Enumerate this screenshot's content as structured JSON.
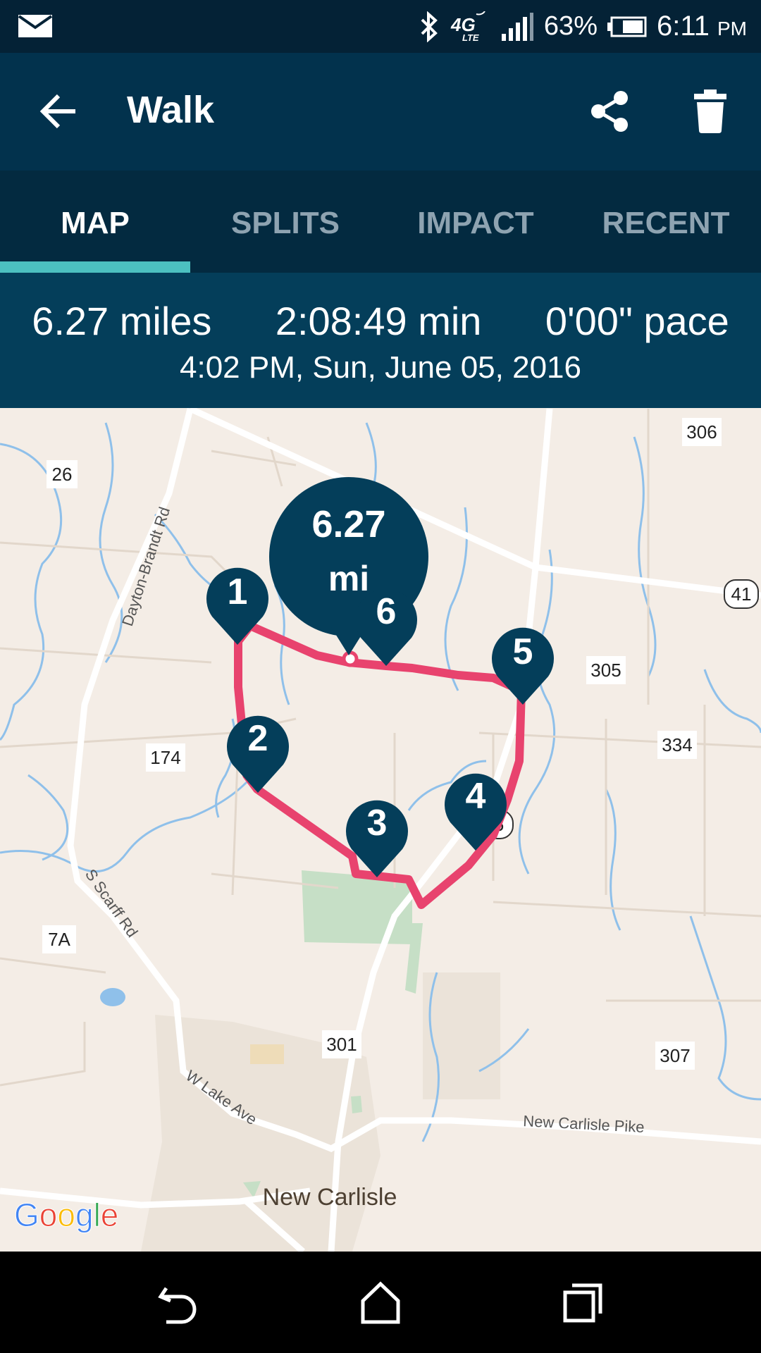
{
  "status_bar": {
    "battery": "63%",
    "time": "6:11",
    "ampm": "PM",
    "network": "4G LTE"
  },
  "app_bar": {
    "title": "Walk"
  },
  "tabs": [
    {
      "label": "MAP",
      "active": true
    },
    {
      "label": "SPLITS",
      "active": false
    },
    {
      "label": "IMPACT",
      "active": false
    },
    {
      "label": "RECENT",
      "active": false
    }
  ],
  "summary": {
    "distance": "6.27 miles",
    "duration": "2:08:49 min",
    "pace": "0'00\" pace",
    "datetime": "4:02 PM, Sun, June 05, 2016"
  },
  "map": {
    "total_marker_value": "6.27",
    "total_marker_unit": "mi",
    "splits": [
      "1",
      "2",
      "3",
      "4",
      "5",
      "6"
    ],
    "route_number_labels": [
      "306",
      "26",
      "41",
      "305",
      "334",
      "174",
      "7A",
      "301",
      "307",
      "5"
    ],
    "road_names": [
      "Dayton-Brandt Rd",
      "S Scarff Rd",
      "W Lake Ave",
      "New Carlisle Pike"
    ],
    "place_name": "New Carlisle",
    "attribution": "Google",
    "colors": {
      "route": "#e8436e",
      "marker": "#043e5a",
      "land": "#f4ede6",
      "water": "#8fc0ea",
      "park": "#c6dfc6"
    }
  }
}
